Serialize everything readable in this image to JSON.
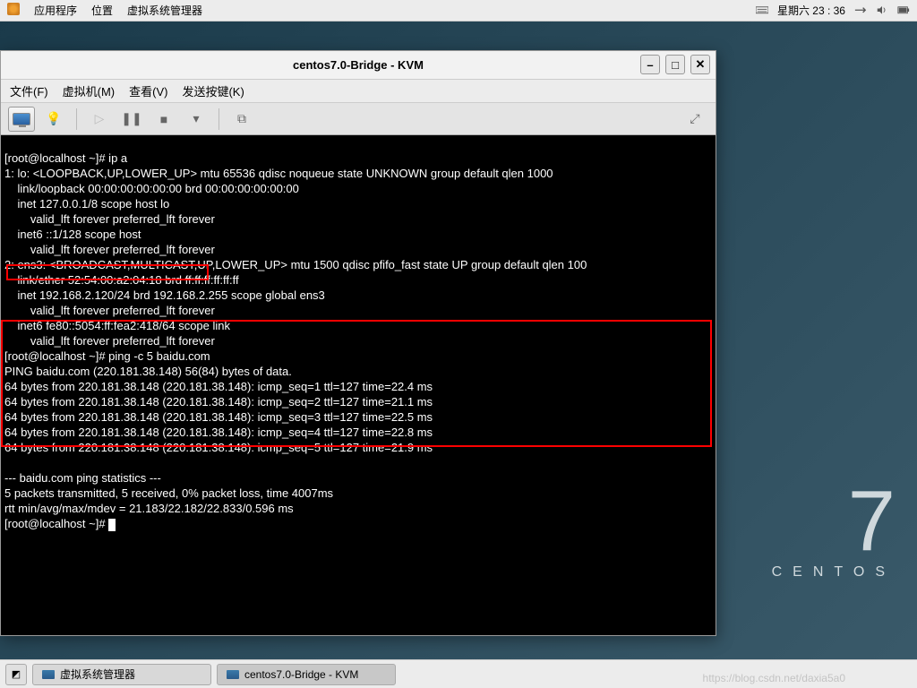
{
  "top_panel": {
    "apps": "应用程序",
    "places": "位置",
    "vmm": "虚拟系统管理器",
    "date": "星期六  23 : 36"
  },
  "bottom_panel": {
    "task1": "虚拟系统管理器",
    "task2": "centos7.0-Bridge - KVM"
  },
  "centos": {
    "seven": "7",
    "name": "CENTOS"
  },
  "window": {
    "title": "centos7.0-Bridge - KVM",
    "menu": {
      "file": "文件(F)",
      "vm": "虚拟机(M)",
      "view": "查看(V)",
      "sendkey": "发送按键(K)"
    }
  },
  "term": {
    "l01": "[root@localhost ~]# ip a",
    "l02": "1: lo: <LOOPBACK,UP,LOWER_UP> mtu 65536 qdisc noqueue state UNKNOWN group default qlen 1000",
    "l03": "    link/loopback 00:00:00:00:00:00 brd 00:00:00:00:00:00",
    "l04": "    inet 127.0.0.1/8 scope host lo",
    "l05": "        valid_lft forever preferred_lft forever",
    "l06": "    inet6 ::1/128 scope host",
    "l07": "        valid_lft forever preferred_lft forever",
    "l08": "2: ens3: <BROADCAST,MULTICAST,UP,LOWER_UP> mtu 1500 qdisc pfifo_fast state UP group default qlen 100",
    "l09": "    link/ether 52:54:00:a2:04:18 brd ff:ff:ff:ff:ff:ff",
    "l10": "    inet 192.168.2.120/24 brd 192.168.2.255 scope global ens3",
    "l11": "        valid_lft forever preferred_lft forever",
    "l12": "    inet6 fe80::5054:ff:fea2:418/64 scope link",
    "l13": "        valid_lft forever preferred_lft forever",
    "l14": "[root@localhost ~]# ping -c 5 baidu.com",
    "l15": "PING baidu.com (220.181.38.148) 56(84) bytes of data.",
    "l16": "64 bytes from 220.181.38.148 (220.181.38.148): icmp_seq=1 ttl=127 time=22.4 ms",
    "l17": "64 bytes from 220.181.38.148 (220.181.38.148): icmp_seq=2 ttl=127 time=21.1 ms",
    "l18": "64 bytes from 220.181.38.148 (220.181.38.148): icmp_seq=3 ttl=127 time=22.5 ms",
    "l19": "64 bytes from 220.181.38.148 (220.181.38.148): icmp_seq=4 ttl=127 time=22.8 ms",
    "l20": "64 bytes from 220.181.38.148 (220.181.38.148): icmp_seq=5 ttl=127 time=21.9 ms",
    "l21": "",
    "l22": "--- baidu.com ping statistics ---",
    "l23": "5 packets transmitted, 5 received, 0% packet loss, time 4007ms",
    "l24": "rtt min/avg/max/mdev = 21.183/22.182/22.833/0.596 ms",
    "l25": "[root@localhost ~]# "
  },
  "watermark": "https://blog.csdn.net/daxia5a0"
}
